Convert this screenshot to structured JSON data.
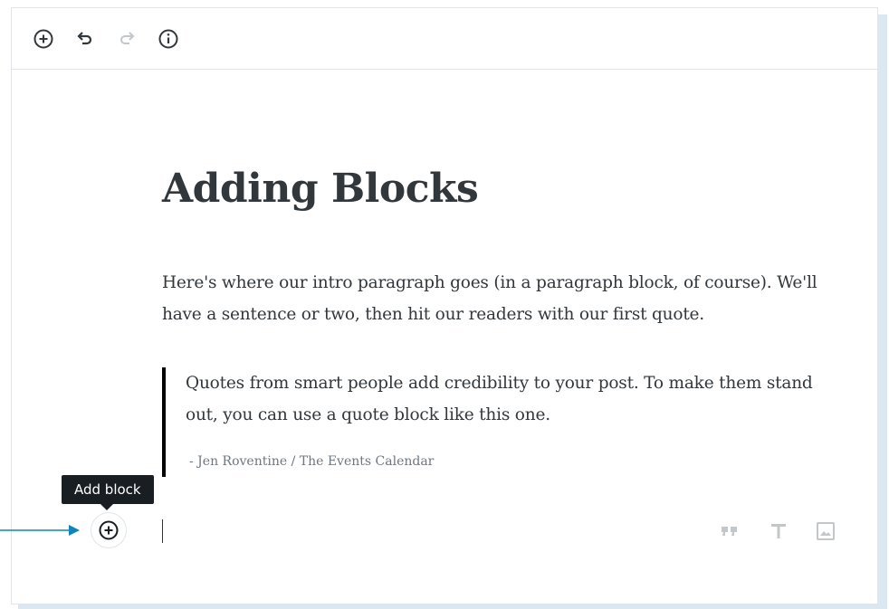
{
  "toolbar": {
    "buttons": [
      {
        "name": "add-block",
        "icon": "plus-circle-icon",
        "enabled": true
      },
      {
        "name": "undo",
        "icon": "undo-icon",
        "enabled": true
      },
      {
        "name": "redo",
        "icon": "redo-icon",
        "enabled": false
      },
      {
        "name": "info",
        "icon": "info-icon",
        "enabled": true
      }
    ]
  },
  "post": {
    "title": "Adding Blocks",
    "intro": "Here's where our intro paragraph goes (in a paragraph block, of course). We'll have a sentence or two, then hit our readers with our first quote.",
    "quote": {
      "text": "Quotes from smart people add credibility to your post. To make them stand out, you can use a quote block like this one.",
      "citation": "- Jen Roventine / The Events Calendar"
    }
  },
  "inserter": {
    "tooltip": "Add block",
    "icon": "plus-circle-icon"
  },
  "shortcuts": [
    {
      "name": "quote",
      "icon": "quote-icon"
    },
    {
      "name": "heading",
      "icon": "heading-icon"
    },
    {
      "name": "image",
      "icon": "image-icon"
    }
  ],
  "colors": {
    "text": "#32373c",
    "muted": "#6c7781",
    "disabled": "#c2c7cc",
    "tooltip_bg": "#191e23",
    "pointer": "#0e86b9",
    "frame_shadow": "#dbe7f1"
  }
}
